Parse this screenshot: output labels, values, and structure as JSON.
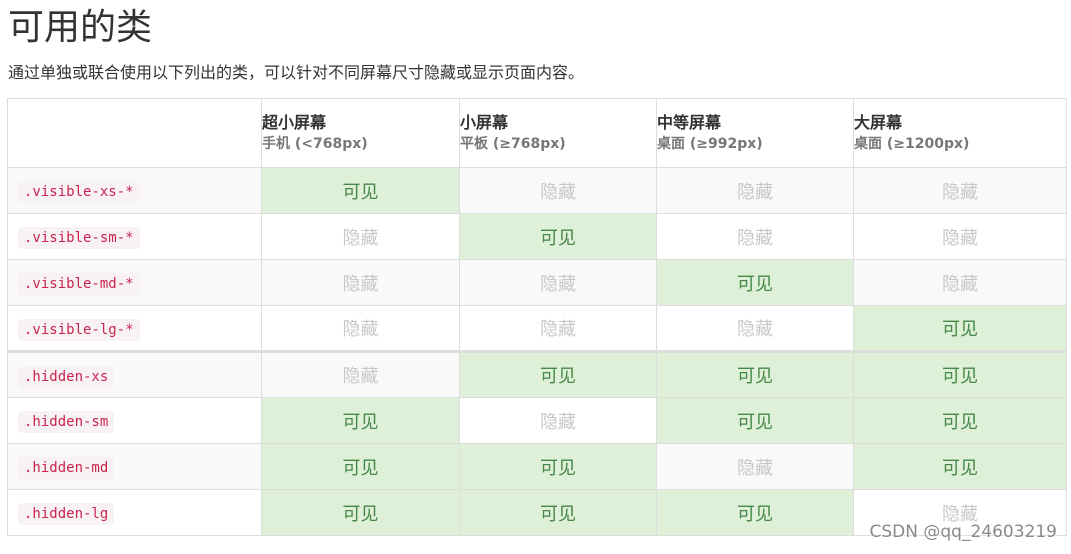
{
  "title": "可用的类",
  "description": "通过单独或联合使用以下列出的类，可以针对不同屏幕尺寸隐藏或显示页面内容。",
  "columns": [
    {
      "name": "超小屏幕",
      "sub": "手机 (<768px)"
    },
    {
      "name": "小屏幕",
      "sub": "平板 (≥768px)"
    },
    {
      "name": "中等屏幕",
      "sub": "桌面 (≥992px)"
    },
    {
      "name": "大屏幕",
      "sub": "桌面 (≥1200px)"
    }
  ],
  "rows": [
    {
      "cls": ".visible-xs-*",
      "cells": [
        "可见",
        "隐藏",
        "隐藏",
        "隐藏"
      ]
    },
    {
      "cls": ".visible-sm-*",
      "cells": [
        "隐藏",
        "可见",
        "隐藏",
        "隐藏"
      ]
    },
    {
      "cls": ".visible-md-*",
      "cells": [
        "隐藏",
        "隐藏",
        "可见",
        "隐藏"
      ]
    },
    {
      "cls": ".visible-lg-*",
      "cells": [
        "隐藏",
        "隐藏",
        "隐藏",
        "可见"
      ]
    },
    {
      "cls": ".hidden-xs",
      "cells": [
        "隐藏",
        "可见",
        "可见",
        "可见"
      ]
    },
    {
      "cls": ".hidden-sm",
      "cells": [
        "可见",
        "隐藏",
        "可见",
        "可见"
      ]
    },
    {
      "cls": ".hidden-md",
      "cells": [
        "可见",
        "可见",
        "隐藏",
        "可见"
      ]
    },
    {
      "cls": ".hidden-lg",
      "cells": [
        "可见",
        "可见",
        "可见",
        "隐藏"
      ]
    }
  ],
  "visible_label": "可见",
  "colors": {
    "visible_bg": "#dff0d8",
    "visible_text": "#468847",
    "hidden_text": "#c8c8c8",
    "code_text": "#c7254e"
  },
  "watermark": "CSDN @qq_24603219"
}
